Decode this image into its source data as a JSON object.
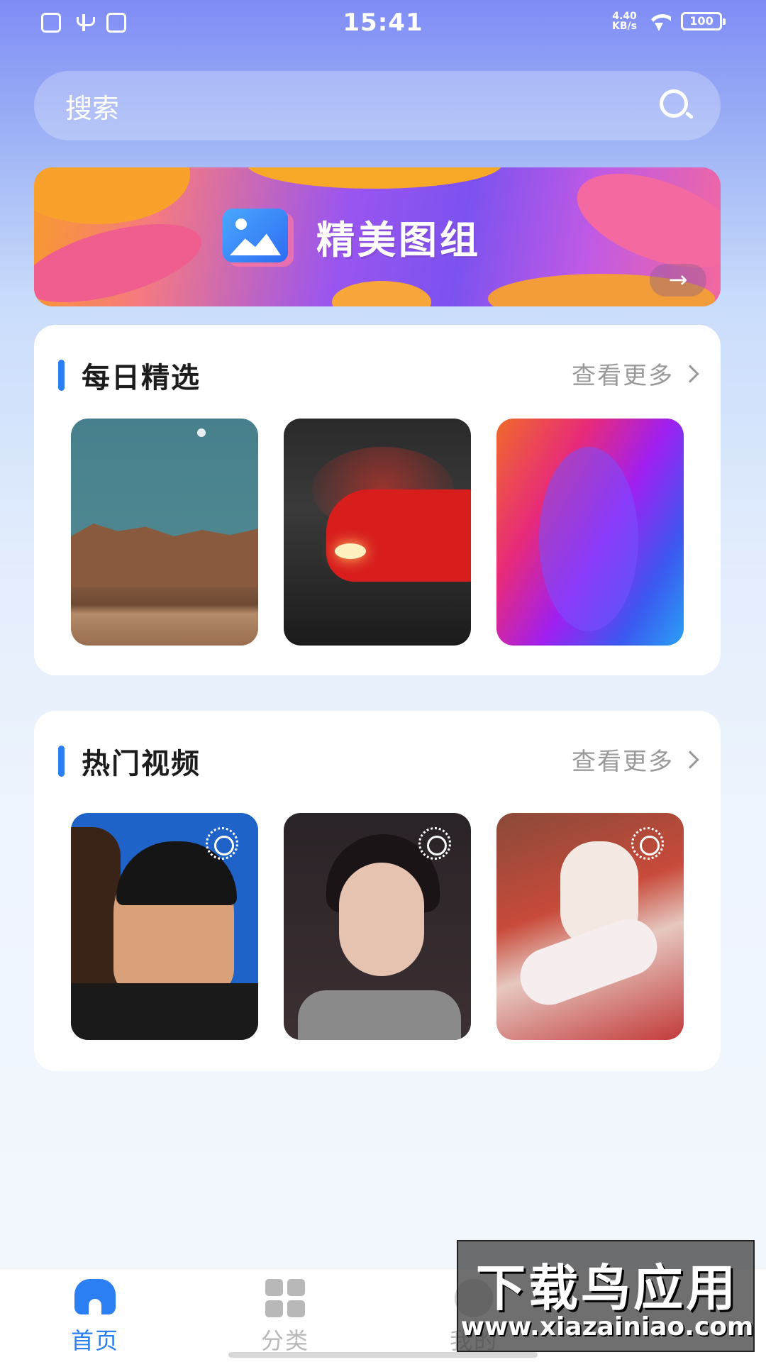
{
  "status_bar": {
    "time": "15:41",
    "net_speed_value": "4.40",
    "net_speed_unit": "KB/s",
    "battery": "100"
  },
  "search": {
    "placeholder": "搜索"
  },
  "banner": {
    "title": "精美图组",
    "arrow": "→"
  },
  "sections": [
    {
      "title": "每日精选",
      "more": "查看更多",
      "items": [
        "landscape-thumbnail",
        "red-car-thumbnail",
        "gradient-thumbnail"
      ]
    },
    {
      "title": "热门视频",
      "more": "查看更多",
      "items": [
        "surprised-man-video",
        "woman-portrait-video",
        "anime-girl-video"
      ]
    }
  ],
  "tabbar": {
    "items": [
      {
        "label": "首页",
        "icon": "home-icon",
        "active": true
      },
      {
        "label": "分类",
        "icon": "grid-icon",
        "active": false
      },
      {
        "label": "我的",
        "icon": "user-icon",
        "active": false
      }
    ]
  },
  "watermark": {
    "title": "下载鸟应用",
    "url": "www.xiazainiao.com"
  },
  "colors": {
    "accent": "#2b7ff3",
    "muted": "#9a9a9a"
  }
}
